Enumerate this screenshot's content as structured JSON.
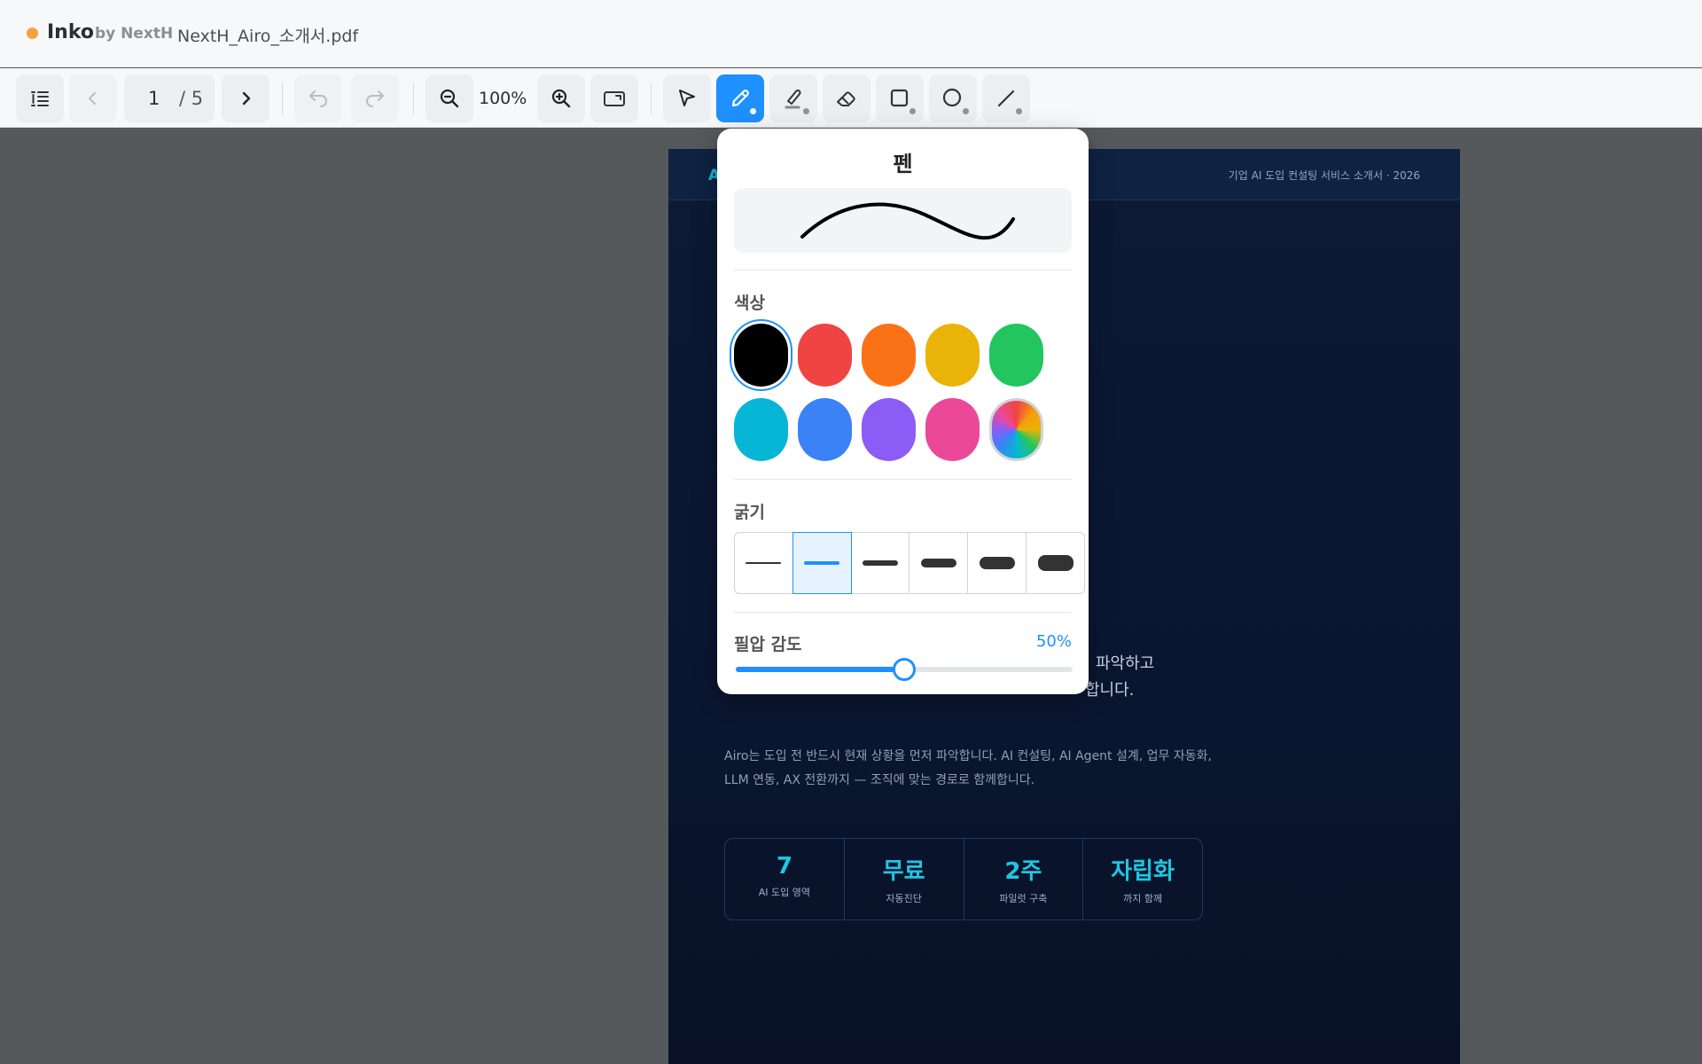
{
  "app": {
    "name": "Inko",
    "by": "by NextH",
    "file_name": "NextH_Airo_소개서.pdf"
  },
  "toolbar": {
    "page_current": "1",
    "page_total": "/ 5",
    "zoom": "100%",
    "icons": {
      "outline": "outline-icon",
      "prev": "chevron-left-icon",
      "next": "chevron-right-icon",
      "undo": "undo-icon",
      "redo": "redo-icon",
      "zoom_out": "zoom-out-icon",
      "zoom_in": "zoom-in-icon",
      "fit": "fit-width-icon",
      "select": "cursor-icon",
      "pen": "pen-icon",
      "highlighter": "highlighter-icon",
      "eraser": "eraser-icon",
      "rectangle": "rectangle-icon",
      "ellipse": "ellipse-icon",
      "line": "line-icon"
    },
    "active_tool": "pen"
  },
  "document": {
    "brand": "A",
    "header_right": "기업 AI 도입 컨설팅 서비스 소개서 · 2026",
    "lead_line1": "파악하고",
    "lead_line2": "합니다.",
    "body_line1": "Airo는 도입 전 반드시 현재 상황을 먼저 파악합니다. AI 컨설팅, AI Agent 설계, 업무 자동화,",
    "body_line2": "LLM 연동, AX 전환까지 — 조직에 맞는 경로로 함께합니다.",
    "stats": [
      {
        "value": "7",
        "label": "AI 도입 영역"
      },
      {
        "value": "무료",
        "label": "자동진단"
      },
      {
        "value": "2주",
        "label": "파일럿 구축"
      },
      {
        "value": "자립화",
        "label": "까지 함께"
      }
    ]
  },
  "pen_panel": {
    "title": "펜",
    "color_label": "색상",
    "colors": [
      "#000000",
      "#ef4444",
      "#f97316",
      "#eab308",
      "#22c55e",
      "#06b6d4",
      "#3b82f6",
      "#8b5cf6",
      "#ec4899",
      "custom-color"
    ],
    "selected_color_index": 0,
    "width_label": "굵기",
    "width_options": [
      1,
      2,
      3,
      5,
      7,
      9
    ],
    "selected_width_index": 1,
    "pressure_label": "필압 감도",
    "pressure_value_text": "50%",
    "pressure_value": 0.5
  }
}
